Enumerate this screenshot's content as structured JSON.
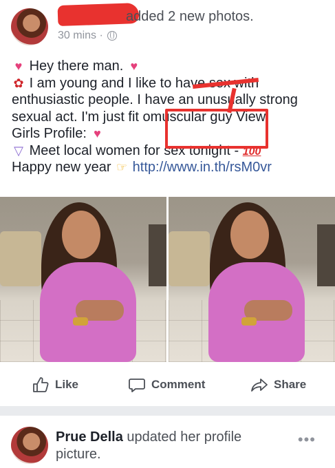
{
  "post": {
    "header_action": "added 2 new photos.",
    "time": "30 mins ·",
    "lines": {
      "l1": "Hey there man.",
      "l2": "I am young and I like to ha",
      "l2b": "ve sex with",
      "l3": "enthusiastic people. I have an unusually strong",
      "l4": "sexual act. I'm just fit o",
      "l4b": "muscular guy",
      "l4c": " View",
      "l5": "Girls Profile:",
      "l6": "Meet local women for sex tonight -",
      "l7": "Happy new year",
      "link": "http://www.in.th/rsM0vr"
    },
    "emoji": {
      "hearts": "💕",
      "lips": "💋",
      "rose": "🌹",
      "cupid": "💘",
      "bikini": "👙",
      "hundred": "100",
      "pointing": "👉"
    }
  },
  "actions": {
    "like": "Like",
    "comment": "Comment",
    "share": "Share"
  },
  "next_post": {
    "name": "Prue Della",
    "action": " updated her profile picture.",
    "more": "•••"
  },
  "colors": {
    "link": "#365899",
    "annotation": "#e8322f",
    "text": "#1d2129",
    "muted": "#90949c"
  }
}
